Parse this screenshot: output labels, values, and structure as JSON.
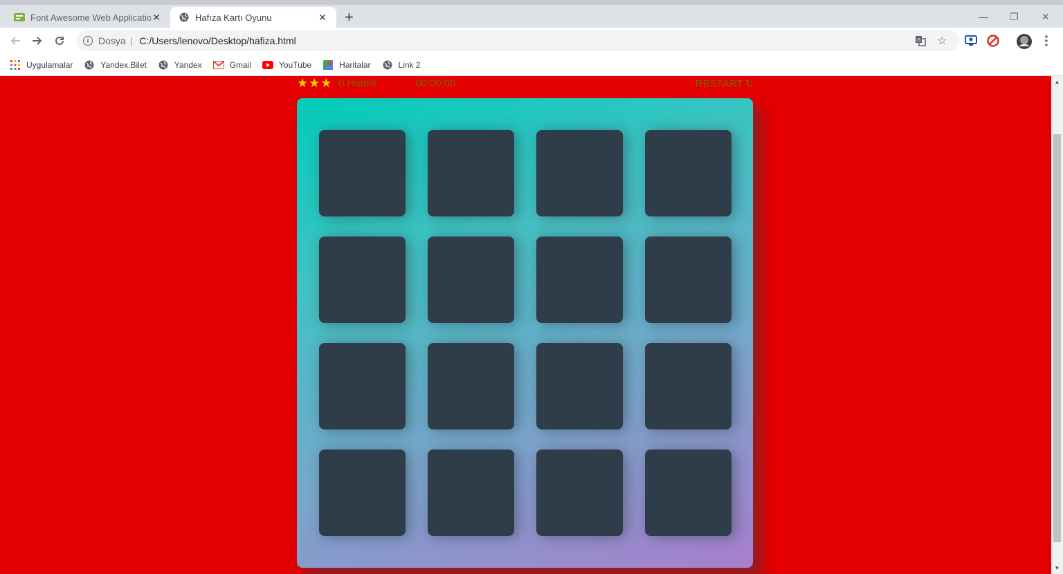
{
  "browser": {
    "tabs": [
      {
        "title": "Font Awesome Web Application",
        "active": false,
        "icon": "font-awesome-favicon"
      },
      {
        "title": "Hafıza Kartı Oyunu",
        "active": true,
        "icon": "globe-icon"
      }
    ],
    "omnibox": {
      "scheme_label": "Dosya",
      "url": "C:/Users/lenovo/Desktop/hafiza.html"
    },
    "bookmarks": [
      {
        "label": "Uygulamalar",
        "icon": "apps-grid-icon"
      },
      {
        "label": "Yandex.Bilet",
        "icon": "globe-icon"
      },
      {
        "label": "Yandex",
        "icon": "globe-icon"
      },
      {
        "label": "Gmail",
        "icon": "gmail-icon"
      },
      {
        "label": "YouTube",
        "icon": "youtube-icon"
      },
      {
        "label": "Haritalar",
        "icon": "maps-icon"
      },
      {
        "label": "Link 2",
        "icon": "globe-icon"
      }
    ]
  },
  "game": {
    "stars": [
      "★",
      "★",
      "★"
    ],
    "moves": "0 Hamle",
    "timer": "00:00:00",
    "restart": "RESTART",
    "restart_icon": "↻",
    "card_count": 16,
    "cards_face_down": true
  },
  "colors": {
    "page_background": "#e40000",
    "card_back": "#2e3d49",
    "deck_gradient_start": "#02ccba",
    "deck_gradient_end": "#aa7ecd",
    "star": "#f5d000"
  }
}
